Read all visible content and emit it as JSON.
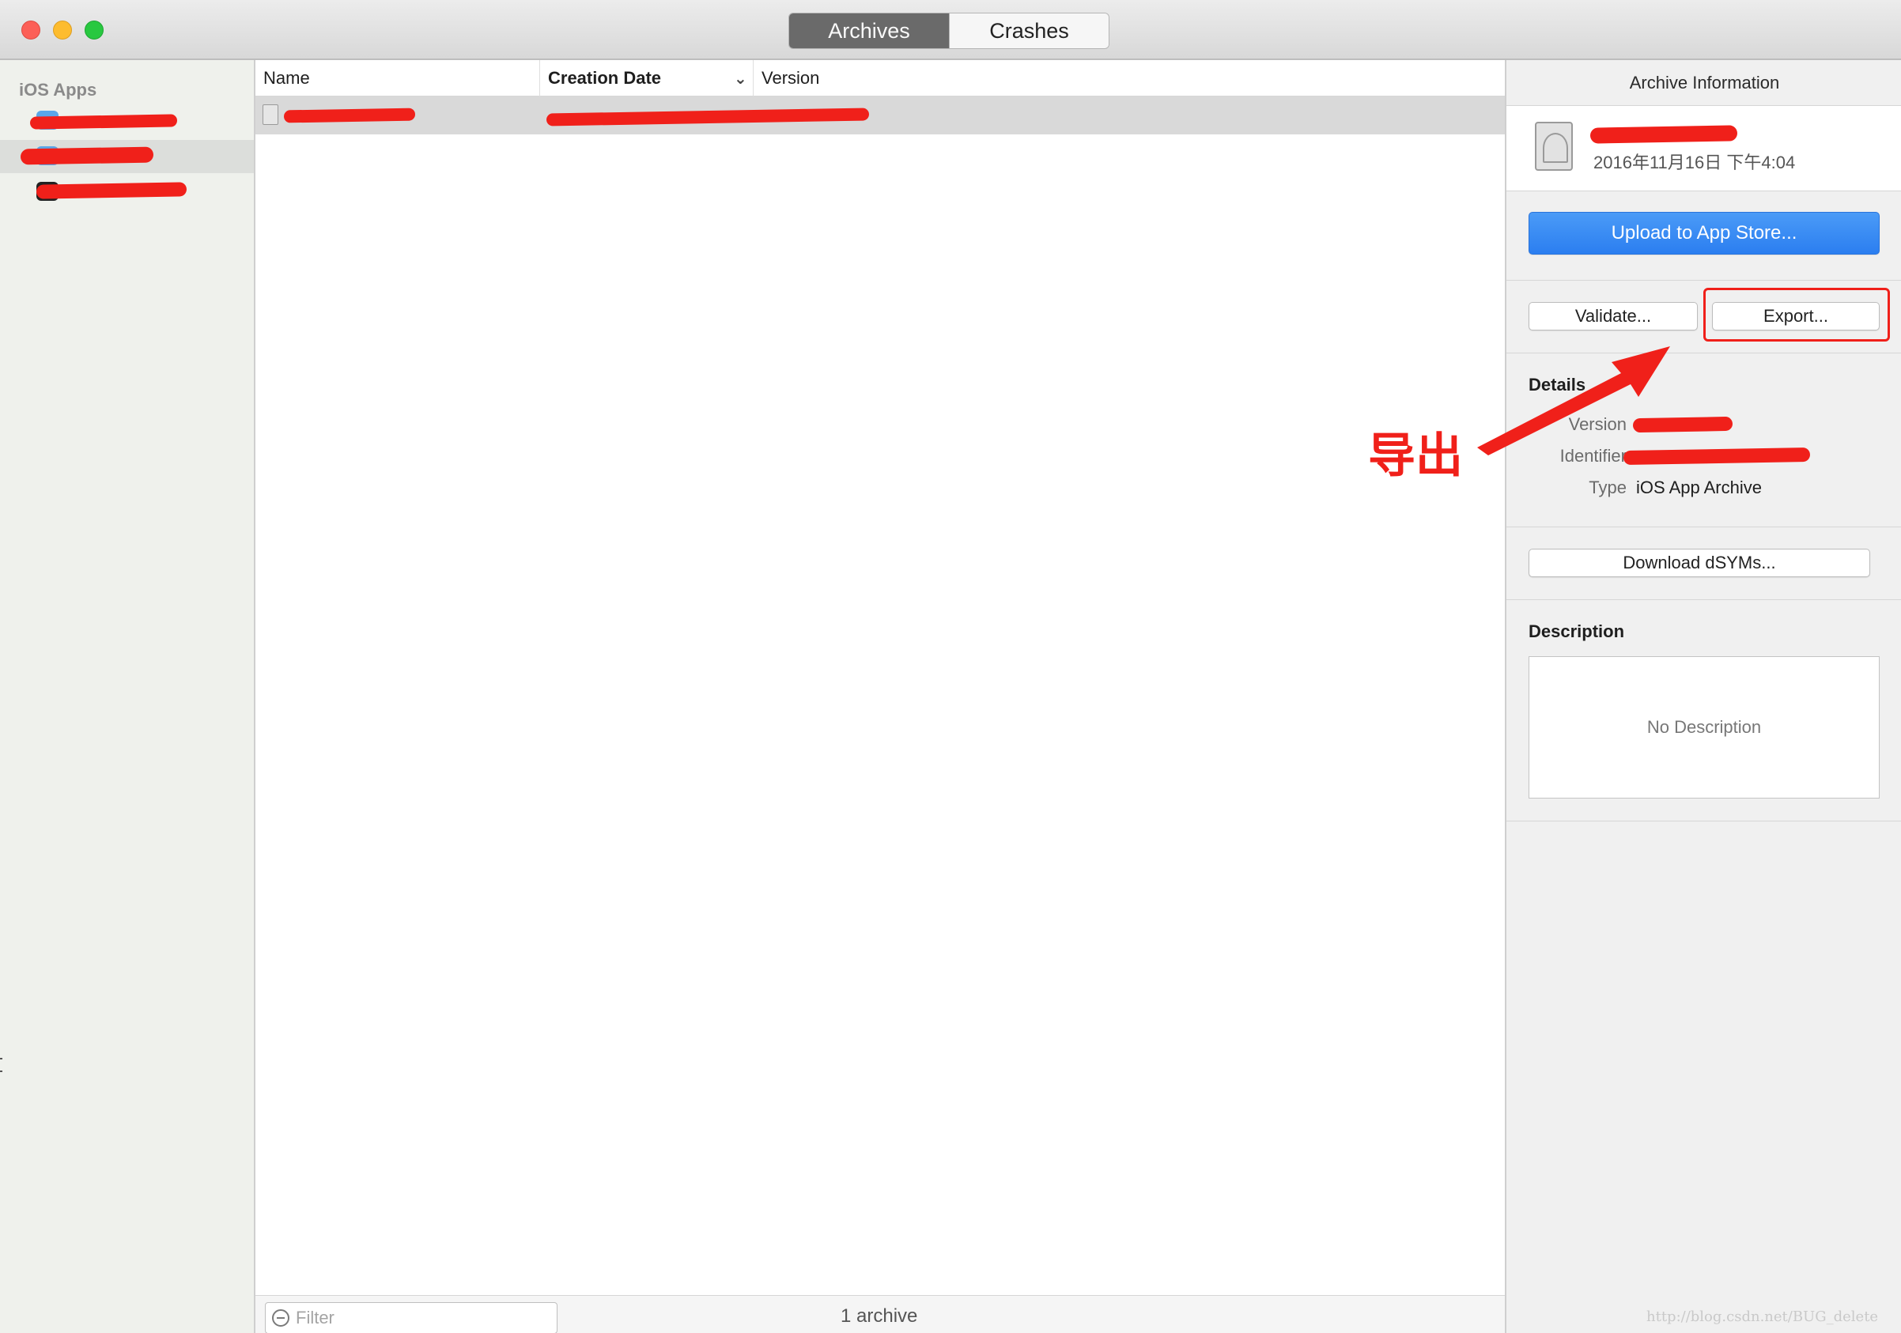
{
  "window": {
    "segmented_control": {
      "archives_label": "Archives",
      "crashes_label": "Crashes",
      "selected": "Archives"
    }
  },
  "sidebar": {
    "heading": "iOS Apps",
    "items": [
      {
        "label": "",
        "redacted": true,
        "selected": false
      },
      {
        "label": "",
        "redacted": true,
        "selected": true
      },
      {
        "label": "",
        "redacted": true,
        "selected": false
      }
    ]
  },
  "archive_list": {
    "columns": {
      "name": "Name",
      "creation_date": "Creation Date",
      "version": "Version",
      "sort_indicator": "chevron-down-icon"
    },
    "rows": [
      {
        "name": "",
        "creation_date": "",
        "version": "",
        "redacted": true,
        "selected": true
      }
    ],
    "filter_placeholder": "Filter",
    "count_label": "1 archive"
  },
  "inspector": {
    "header": "Archive Information",
    "archive_date": "2016年11月16日 下午4:04",
    "upload_button": "Upload to App Store...",
    "validate_button": "Validate...",
    "export_button": "Export...",
    "details_title": "Details",
    "details": [
      {
        "label": "Version",
        "value": ""
      },
      {
        "label": "Identifier",
        "value": ""
      },
      {
        "label": "Type",
        "value": "iOS App Archive"
      }
    ],
    "dsyms_button": "Download dSYMs...",
    "description_title": "Description",
    "description_placeholder": "No Description"
  },
  "annotation": {
    "text": "导出",
    "color": "#f0201a"
  },
  "watermark": "http://blog.csdn.net/BUG_delete",
  "colors": {
    "accent_blue": "#2b7ef0",
    "redaction_red": "#f0201a",
    "selected_row": "#d9d9d9"
  }
}
